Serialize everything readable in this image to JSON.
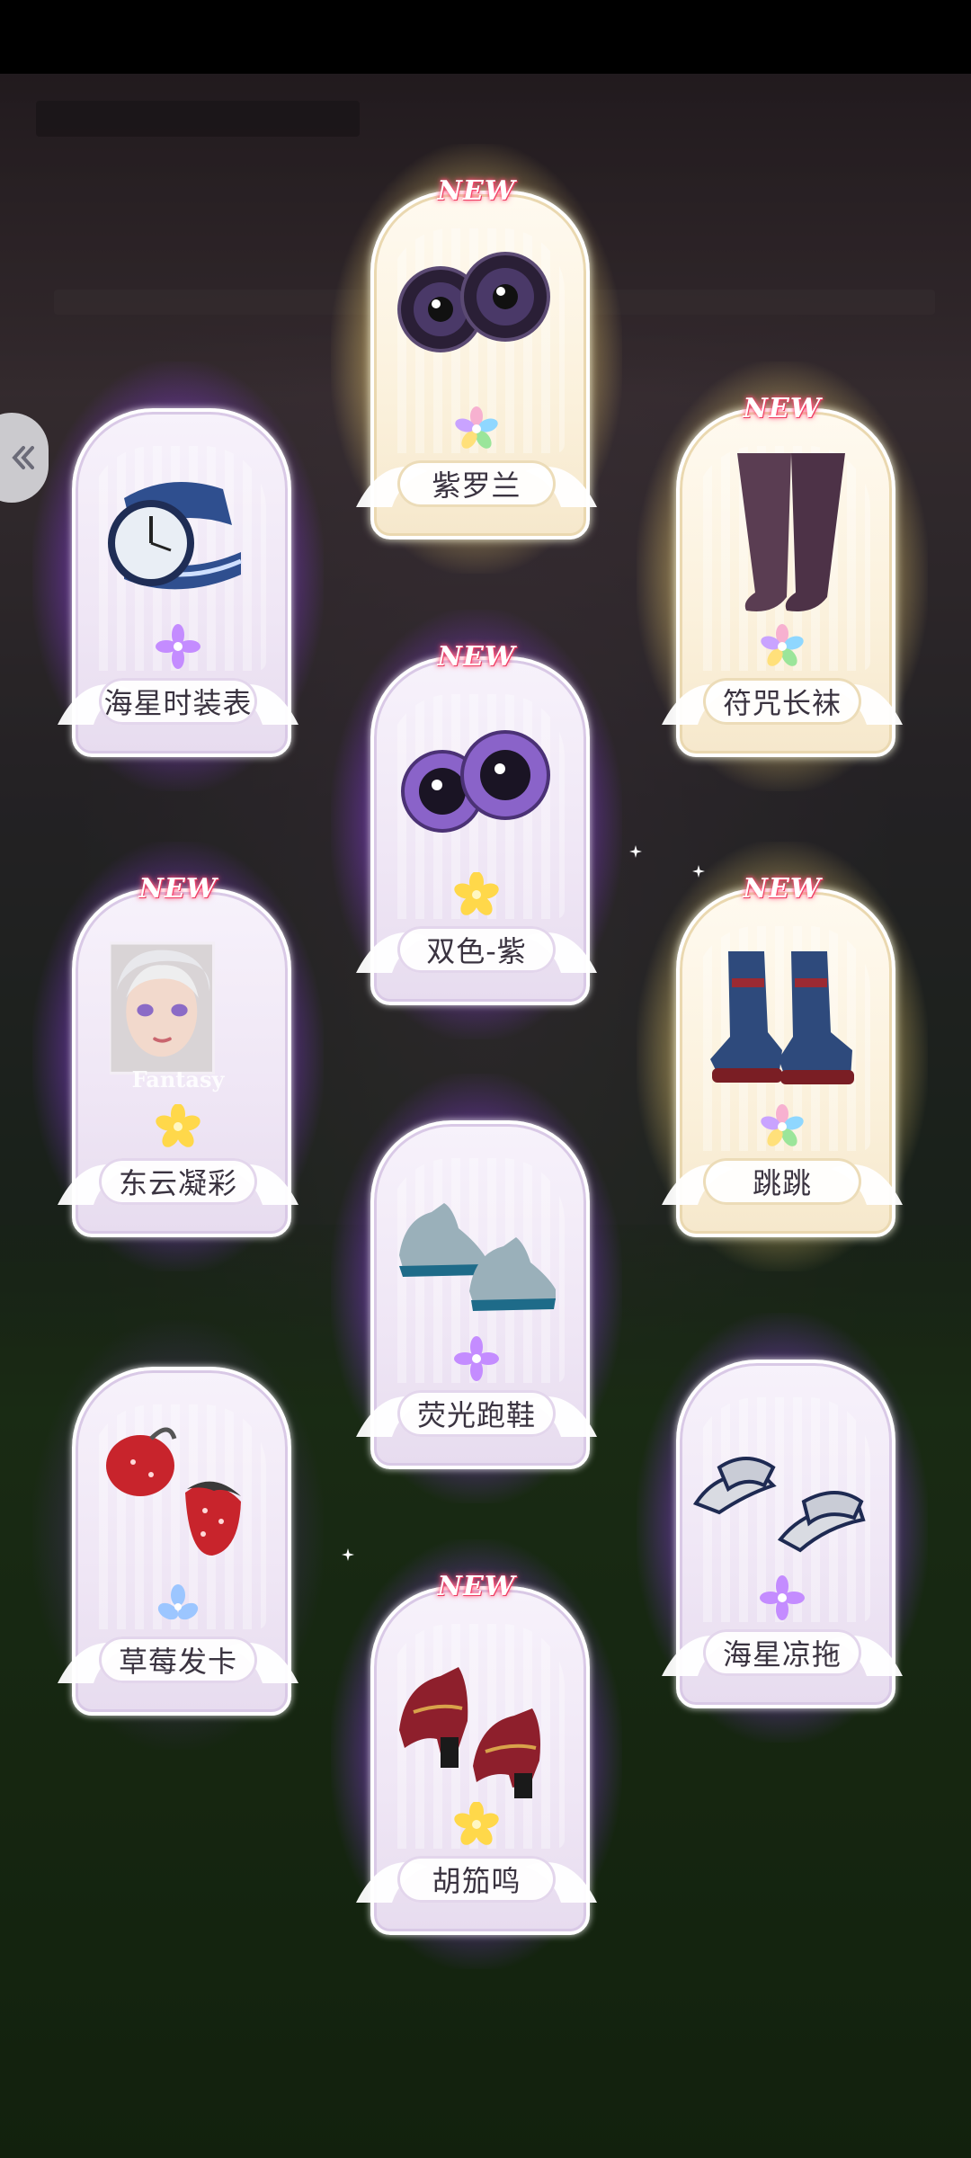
{
  "items": [
    {
      "name": "紫罗兰",
      "new": "NEW",
      "rarity": "rainbow",
      "art": "eye-lenses-dark-purple"
    },
    {
      "name": "海星时装表",
      "new": "",
      "rarity": "purple",
      "art": "wrist-watch"
    },
    {
      "name": "符咒长袜",
      "new": "NEW",
      "rarity": "rainbow",
      "art": "long-stockings"
    },
    {
      "name": "双色-紫",
      "new": "NEW",
      "rarity": "gold",
      "art": "eye-lenses-purple"
    },
    {
      "name": "东云凝彩",
      "new": "NEW",
      "rarity": "gold",
      "art": "makeup-portrait",
      "caption": "Fantasy"
    },
    {
      "name": "跳跳",
      "new": "NEW",
      "rarity": "rainbow",
      "art": "high-top-sneakers"
    },
    {
      "name": "荧光跑鞋",
      "new": "",
      "rarity": "purple",
      "art": "running-shoes"
    },
    {
      "name": "草莓发卡",
      "new": "",
      "rarity": "blue",
      "art": "strawberry-hairclip"
    },
    {
      "name": "海星凉拖",
      "new": "",
      "rarity": "purple",
      "art": "slides"
    },
    {
      "name": "胡笳鸣",
      "new": "NEW",
      "rarity": "gold",
      "art": "mary-jane-shoes"
    }
  ],
  "side_button": {
    "icon": "double-chevron-left-icon"
  },
  "colors": {
    "purple_glow": "#a05aff",
    "gold_glow": "#ffe08a",
    "new_badge": "#ff3a6a"
  }
}
